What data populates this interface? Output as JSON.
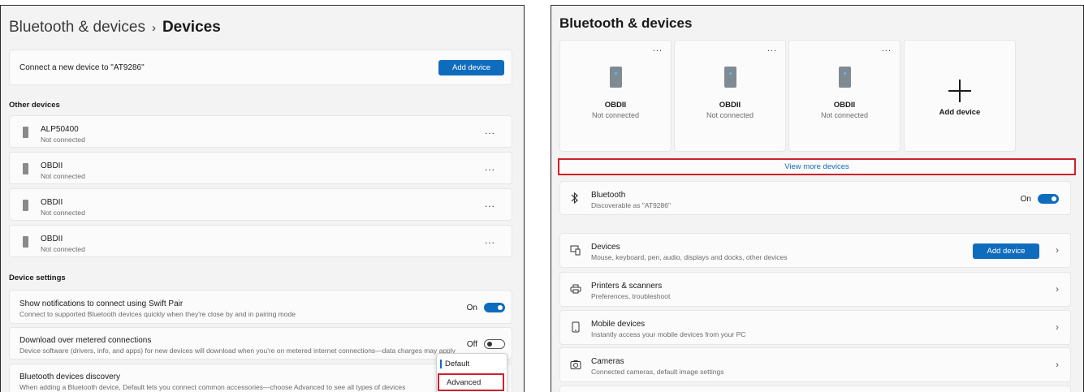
{
  "left": {
    "breadcrumb": {
      "parent": "Bluetooth & devices",
      "separator": "›",
      "current": "Devices"
    },
    "connect": {
      "text": "Connect a new device to \"AT9286\"",
      "button": "Add device"
    },
    "other_devices_heading": "Other devices",
    "devices": [
      {
        "name": "ALP50400",
        "status": "Not connected",
        "more": "..."
      },
      {
        "name": "OBDII",
        "status": "Not connected",
        "more": "..."
      },
      {
        "name": "OBDII",
        "status": "Not connected",
        "more": "..."
      },
      {
        "name": "OBDII",
        "status": "Not connected",
        "more": "..."
      }
    ],
    "settings_heading": "Device settings",
    "swift_pair": {
      "title": "Show notifications to connect using Swift Pair",
      "desc": "Connect to supported Bluetooth devices quickly when they're close by and in pairing mode",
      "state": "On"
    },
    "metered": {
      "title": "Download over metered connections",
      "desc": "Device software (drivers, info, and apps) for new devices will download when you're on metered internet connections—data charges may apply",
      "state": "Off"
    },
    "discovery": {
      "title": "Bluetooth devices discovery",
      "desc": "When adding a Bluetooth device, Default lets you connect common accessories—choose Advanced to see all types of devices",
      "options": [
        "Default",
        "Advanced"
      ]
    }
  },
  "right": {
    "title": "Bluetooth & devices",
    "tiles": [
      {
        "name": "OBDII",
        "status": "Not connected",
        "more": "..."
      },
      {
        "name": "OBDII",
        "status": "Not connected",
        "more": "..."
      },
      {
        "name": "OBDII",
        "status": "Not connected",
        "more": "..."
      }
    ],
    "add_tile_label": "Add device",
    "view_more": "View more devices",
    "bluetooth": {
      "title": "Bluetooth",
      "desc": "Discoverable as \"AT9286\"",
      "state": "On"
    },
    "rows": [
      {
        "title": "Devices",
        "desc": "Mouse, keyboard, pen, audio, displays and docks, other devices",
        "button": "Add device"
      },
      {
        "title": "Printers & scanners",
        "desc": "Preferences, troubleshoot"
      },
      {
        "title": "Mobile devices",
        "desc": "Instantly access your mobile devices from your PC"
      },
      {
        "title": "Cameras",
        "desc": "Connected cameras, default image settings"
      }
    ]
  },
  "colors": {
    "accent": "#0f6cbd",
    "highlight": "#d0202a"
  }
}
